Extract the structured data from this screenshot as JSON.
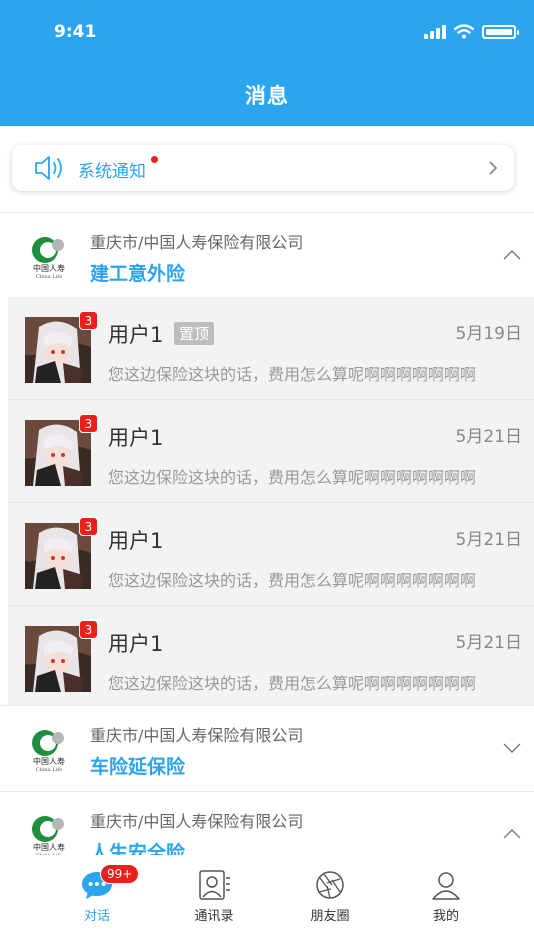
{
  "status_bar": {
    "time": "9:41"
  },
  "header": {
    "title": "消息"
  },
  "notice": {
    "label": "系统通知",
    "icon": "speaker-icon",
    "has_unread_dot": true
  },
  "companies": [
    {
      "name": "重庆市/中国人寿保险有限公司",
      "product": "建工意外险",
      "expanded": true,
      "logo_text": "中国人寿",
      "logo_sub": "China Life"
    },
    {
      "name": "重庆市/中国人寿保险有限公司",
      "product": "车险延保险",
      "expanded": false,
      "logo_text": "中国人寿",
      "logo_sub": "China Life"
    },
    {
      "name": "重庆市/中国人寿保险有限公司",
      "product": "人生安全险",
      "expanded": true,
      "logo_text": "中国人寿",
      "logo_sub": "China Life"
    }
  ],
  "conversations": [
    {
      "user": "用户1",
      "pinned_label": "置顶",
      "date": "5月19日",
      "preview": "您这边保险这块的话，费用怎么算呢啊啊啊啊啊啊啊",
      "unread": "3"
    },
    {
      "user": "用户1",
      "date": "5月21日",
      "preview": "您这边保险这块的话，费用怎么算呢啊啊啊啊啊啊啊",
      "unread": "3"
    },
    {
      "user": "用户1",
      "date": "5月21日",
      "preview": "您这边保险这块的话，费用怎么算呢啊啊啊啊啊啊啊",
      "unread": "3"
    },
    {
      "user": "用户1",
      "date": "5月21日",
      "preview": "您这边保险这块的话，费用怎么算呢啊啊啊啊啊啊啊",
      "unread": "3"
    }
  ],
  "tabbar": {
    "chat": {
      "label": "对话",
      "badge": "99+",
      "icon": "chat-bubble-icon"
    },
    "contacts": {
      "label": "通讯录",
      "icon": "contacts-icon"
    },
    "moments": {
      "label": "朋友圈",
      "icon": "aperture-icon"
    },
    "me": {
      "label": "我的",
      "icon": "person-icon"
    }
  },
  "colors": {
    "brand": "#2BA5EF",
    "badge": "#E8211B",
    "logo_green": "#1F8F3F"
  }
}
